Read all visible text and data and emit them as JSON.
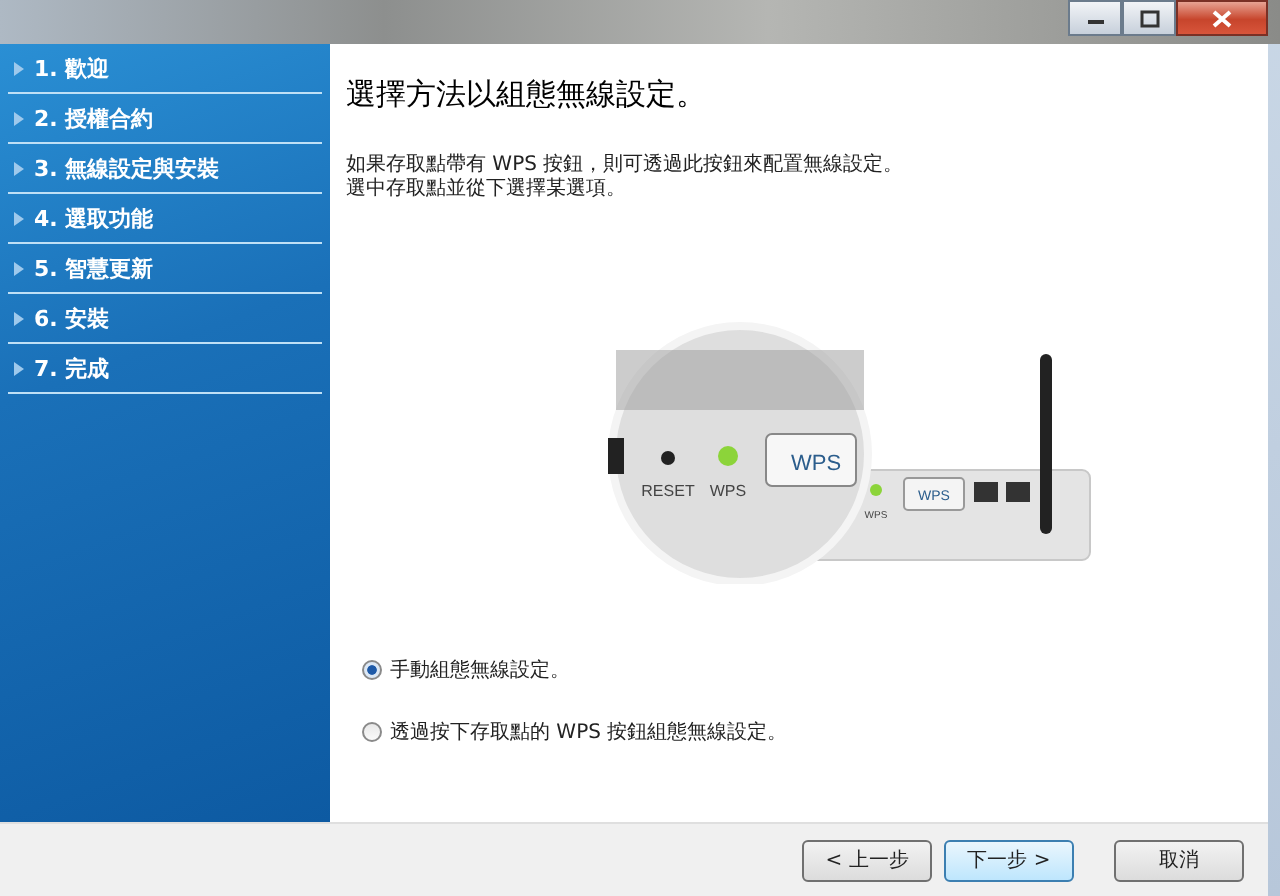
{
  "sidebar": {
    "items": [
      {
        "label": "1. 歡迎"
      },
      {
        "label": "2. 授權合約"
      },
      {
        "label": "3. 無線設定與安裝"
      },
      {
        "label": "4. 選取功能"
      },
      {
        "label": "5. 智慧更新"
      },
      {
        "label": "6. 安裝"
      },
      {
        "label": "7. 完成"
      }
    ]
  },
  "main": {
    "heading": "選擇方法以組態無線設定。",
    "description": [
      "如果存取點帶有 WPS 按鈕，則可透過此按鈕來配置無線設定。",
      "選中存取點並從下選擇某選項。"
    ],
    "illustration": {
      "reset_label": "RESET",
      "led_label": "WPS",
      "button_label": "WPS",
      "router_led_label": "WPS",
      "router_button_label": "WPS"
    },
    "options": [
      {
        "label": "手動組態無線設定。",
        "selected": true
      },
      {
        "label": "透過按下存取點的 WPS 按鈕組態無線設定。",
        "selected": false
      }
    ]
  },
  "buttons": [
    {
      "label": "< 上一步",
      "default": false
    },
    {
      "label": "下一步 >",
      "default": true
    },
    {
      "label": "取消",
      "default": false
    }
  ]
}
